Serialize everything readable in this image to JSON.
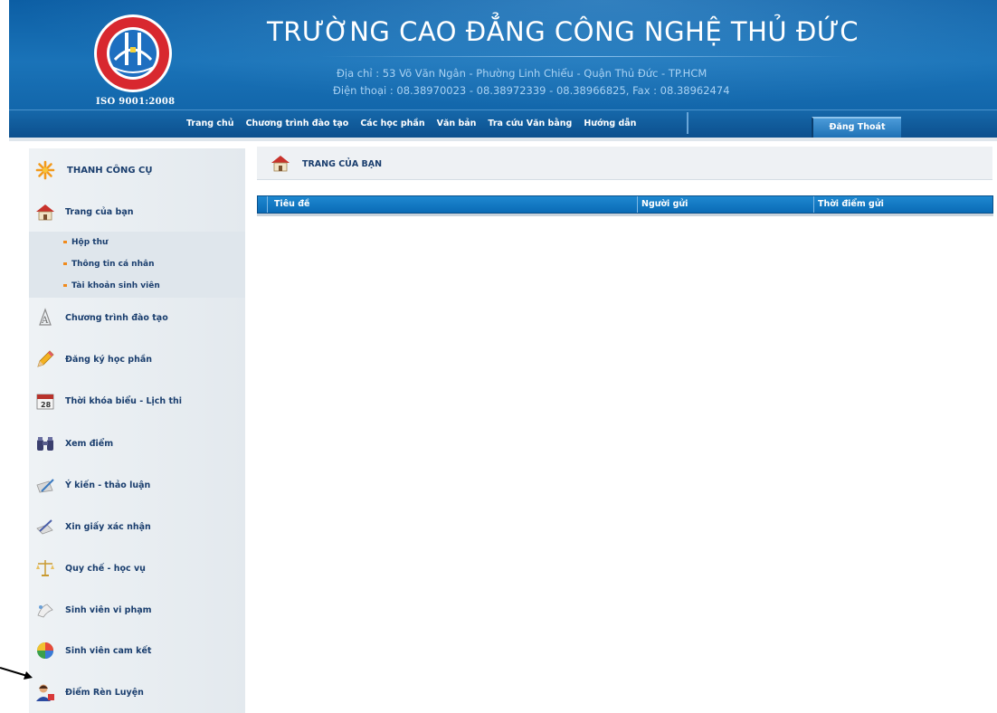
{
  "header": {
    "school_name": "TRƯỜNG CAO ĐẲNG CÔNG NGHỆ THỦ ĐỨC",
    "address": "Địa chỉ : 53 Võ Văn Ngân - Phường Linh Chiểu - Quận Thủ Đức - TP.HCM",
    "phone": "Điện thoại : 08.38970023 - 08.38972339 - 08.38966825, Fax : 08.38962474",
    "iso": "ISO 9001:2008",
    "logo_icon": "school-seal-logo"
  },
  "nav": {
    "items": [
      "Trang chủ",
      "Chương trình đào tạo",
      "Các học phần",
      "Văn bản",
      "Tra cứu Văn bằng",
      "Hướng dẫn"
    ],
    "logout_label": "Đăng Thoát"
  },
  "sidebar": {
    "header": "THANH CÔNG CỤ",
    "items": [
      {
        "label": "Trang của bạn",
        "icon": "home-icon"
      },
      {
        "label": "Chương trình đào tạo",
        "icon": "curriculum-icon"
      },
      {
        "label": "Đăng ký học phần",
        "icon": "pencil-icon"
      },
      {
        "label": "Thời khóa biểu - Lịch thi",
        "icon": "calendar-icon"
      },
      {
        "label": "Xem điểm",
        "icon": "binoculars-icon"
      },
      {
        "label": "Ý kiến - thảo luận",
        "icon": "feedback-icon"
      },
      {
        "label": "Xin giấy xác nhận",
        "icon": "certificate-icon"
      },
      {
        "label": "Quy chế - học vụ",
        "icon": "scales-icon"
      },
      {
        "label": "Sinh viên vi phạm",
        "icon": "violation-icon"
      },
      {
        "label": "Sinh viên cam kết",
        "icon": "commitment-icon"
      },
      {
        "label": "Điểm Rèn Luyện",
        "icon": "user-icon"
      }
    ],
    "subitems": [
      "Hộp thư",
      "Thông tin cá nhân",
      "Tài khoản sinh viên"
    ]
  },
  "main": {
    "breadcrumb": "TRANG CỦA BẠN",
    "table_headers": [
      "Tiêu đề",
      "Người gửi",
      "Thời điểm gửi"
    ]
  },
  "colors": {
    "header_blue": "#0c5ea4",
    "table_header_blue": "#1e88d0",
    "sidebar_bg": "#eef2f5",
    "label_navy": "#1a3e6e",
    "bullet_orange": "#f08a1c"
  }
}
